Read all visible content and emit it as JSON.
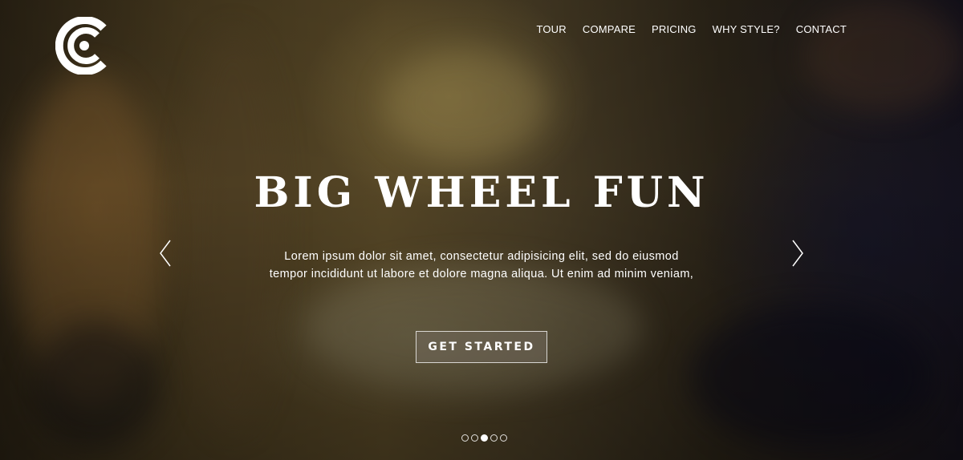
{
  "nav": {
    "items": [
      {
        "label": "TOUR"
      },
      {
        "label": "COMPARE"
      },
      {
        "label": "PRICING"
      },
      {
        "label": "WHY STYLE?"
      },
      {
        "label": "CONTACT"
      }
    ]
  },
  "hero": {
    "title": "BIG WHEEL FUN",
    "subtitle_line1": "Lorem ipsum dolor sit amet, consectetur adipisicing elit, sed do eiusmod",
    "subtitle_line2": "tempor incididunt ut labore et dolore magna aliqua. Ut enim ad minim veniam,",
    "cta_label": "GET STARTED"
  },
  "slider": {
    "total_slides": 5,
    "active_index": 2
  },
  "icons": {
    "logo": "concentric-c-logo",
    "prev": "chevron-left-icon",
    "next": "chevron-right-icon"
  },
  "colors": {
    "text": "#ffffff",
    "accent": "#ffffff"
  }
}
